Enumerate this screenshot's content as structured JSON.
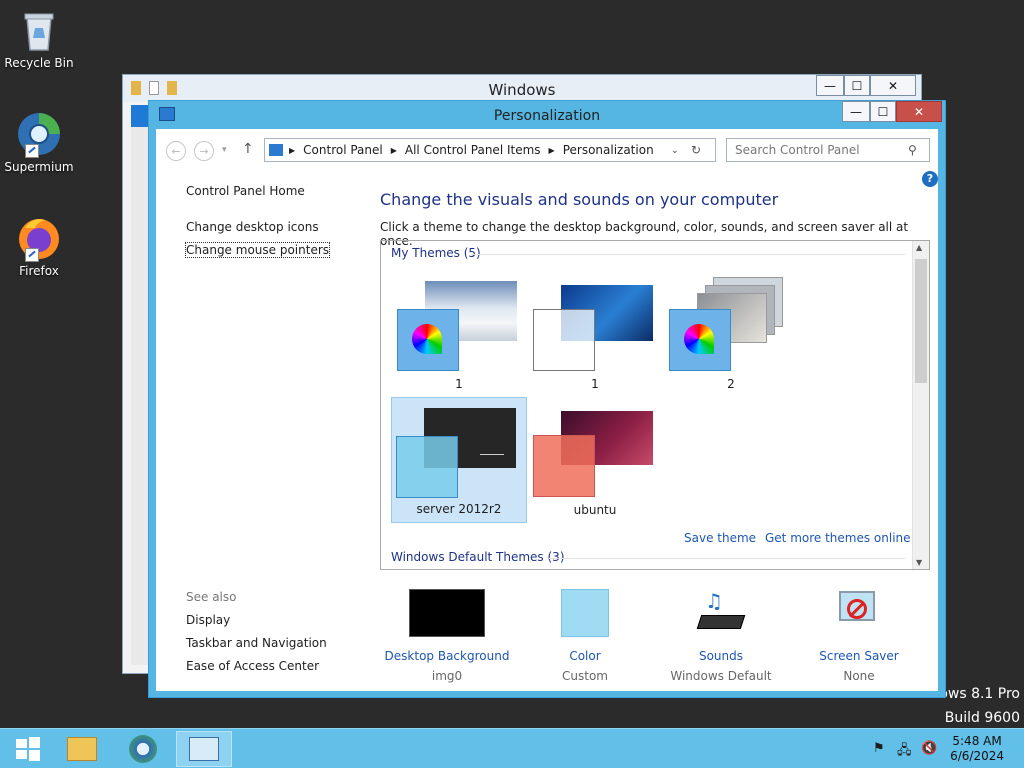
{
  "desktop": {
    "icons": [
      {
        "label": "Recycle Bin"
      },
      {
        "label": "Supermium"
      },
      {
        "label": "Firefox"
      }
    ],
    "watermark_line1": "ows 8.1 Pro",
    "watermark_line2": "Build 9600"
  },
  "back_window": {
    "title": "Windows",
    "controls": {
      "min": "—",
      "max": "☐",
      "close": "✕"
    }
  },
  "window": {
    "title": "Personalization",
    "controls": {
      "min": "—",
      "max": "☐",
      "close": "✕"
    },
    "breadcrumb": [
      "Control Panel",
      "All Control Panel Items",
      "Personalization"
    ],
    "search_placeholder": "Search Control Panel",
    "left_nav": {
      "home": "Control Panel Home",
      "desktop_icons": "Change desktop icons",
      "mouse_pointers": "Change mouse pointers"
    },
    "see_also": {
      "heading": "See also",
      "items": [
        "Display",
        "Taskbar and Navigation",
        "Ease of Access Center"
      ]
    },
    "heading": "Change the visuals and sounds on your computer",
    "subheading": "Click a theme to change the desktop background, color, sounds, and screen saver all at once.",
    "my_themes_label": "My Themes (5)",
    "default_themes_label": "Windows Default Themes (3)",
    "themes": [
      {
        "name": "1"
      },
      {
        "name": "1"
      },
      {
        "name": "2"
      },
      {
        "name": "server 2012r2",
        "selected": true
      },
      {
        "name": "ubuntu"
      }
    ],
    "save_theme": "Save theme",
    "get_more": "Get more themes online",
    "bottom": [
      {
        "name": "Desktop Background",
        "value": "img0"
      },
      {
        "name": "Color",
        "value": "Custom"
      },
      {
        "name": "Sounds",
        "value": "Windows Default"
      },
      {
        "name": "Screen Saver",
        "value": "None"
      }
    ]
  },
  "taskbar": {
    "time": "5:48 AM",
    "date": "6/6/2024"
  },
  "colors": {
    "accent": "#55b6e3",
    "taskbar": "#62bfe8",
    "link": "#1e56b3"
  }
}
